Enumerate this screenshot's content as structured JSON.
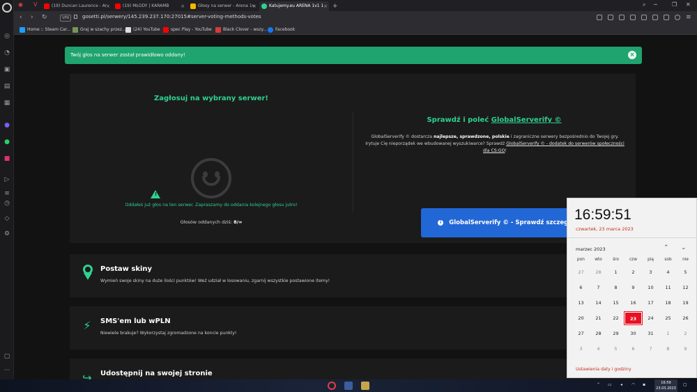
{
  "browser": {
    "tabs": [
      {
        "label": "(19) Duncan Laurence - Ar",
        "fav": "#ff0000"
      },
      {
        "label": "(19) MŁODY | KARAMB",
        "fav": "#ff0000"
      },
      {
        "label": "Głosy na serwer - Arena 1v",
        "fav": "#f5b700"
      },
      {
        "label": "Katujemy.eu ARENA 1v1 1",
        "fav": "#2ed28e"
      }
    ],
    "tab_plus": "+",
    "url": "gosetti.pl/serwery/145.239.237.170:27015#server-voting-methods-votes",
    "vpn": "VPN",
    "bookmarks": [
      {
        "label": "Home :: Steam Car...",
        "fav": "#1a9fff"
      },
      {
        "label": "Graj w szachy przez...",
        "fav": "#769656"
      },
      {
        "label": "(24) YouTube",
        "fav": "#dddddd"
      },
      {
        "label": "spec Play - YouTube",
        "fav": "#ff0000"
      },
      {
        "label": "Black Clover - wszy...",
        "fav": "#d93a3a"
      },
      {
        "label": "Facebook",
        "fav": "#1877f2"
      }
    ]
  },
  "alert": {
    "text": "Twój głos na serwer został prawidłowo oddany!",
    "close": "×"
  },
  "vote": {
    "title": "Zagłosuj na wybrany serwer!",
    "warn_glyph": "!",
    "message": "Oddałeś już głos na ten serwer. Zapraszamy do oddania kolejnego głosu jutro!",
    "today_label": "Głosów oddanych dziś:",
    "today_value": "8/∞"
  },
  "globalserverify": {
    "title_prefix": "Sprawdź i poleć",
    "title_link": "GlobalServerify ©",
    "desc_1": "GlobalServerify © dostarcza",
    "desc_b1": "najlepsze, sprawdzone, polskie",
    "desc_2": "i zagraniczne serwery bezpośrednio do Twojej gry.",
    "desc_3": "Irytuje Cię nieporządek we wbudowanej wyszukiwarce? Sprawdź",
    "desc_link": "GlobalServerify © - dodatek do serwerów społeczności dla CS:GO",
    "desc_end": "!",
    "button": "GlobalServerify © - Sprawdź szczegóły",
    "info_glyph": "i"
  },
  "features": [
    {
      "title": "Postaw skiny",
      "desc": "Wymień swoje skiny na duże ilości punktów! Weź udział w losowaniu, zgarnij wszystkie postawione itemy!"
    },
    {
      "title": "SMS'em lub wPLN",
      "desc": "Niewiele brakuje? Wykorzystaj zgromadzone na koncie punkty!"
    },
    {
      "title": "Udostępnij na swojej stronie",
      "desc": ""
    }
  ],
  "calendar": {
    "time": "16:59:51",
    "date": "czwartek, 23 marca 2023",
    "month": "marzec 2023",
    "dow": [
      "pon",
      "wto",
      "śro",
      "czw",
      "pią",
      "sob",
      "nie"
    ],
    "days": [
      "27",
      "28",
      "1",
      "2",
      "3",
      "4",
      "5",
      "6",
      "7",
      "8",
      "9",
      "10",
      "11",
      "12",
      "13",
      "14",
      "15",
      "16",
      "17",
      "18",
      "19",
      "20",
      "21",
      "22",
      "23",
      "24",
      "25",
      "26",
      "27",
      "28",
      "29",
      "30",
      "31",
      "1",
      "2",
      "3",
      "4",
      "5",
      "6",
      "7",
      "8",
      "9"
    ],
    "today_index": 24,
    "settings": "Ustawienia daty i godziny"
  },
  "taskbar": {
    "time": "16:59",
    "date": "23.03.2023"
  },
  "colors": {
    "accent": "#2ed28e",
    "alert": "#1fa36f",
    "button": "#2267d6",
    "today": "#e81123"
  }
}
